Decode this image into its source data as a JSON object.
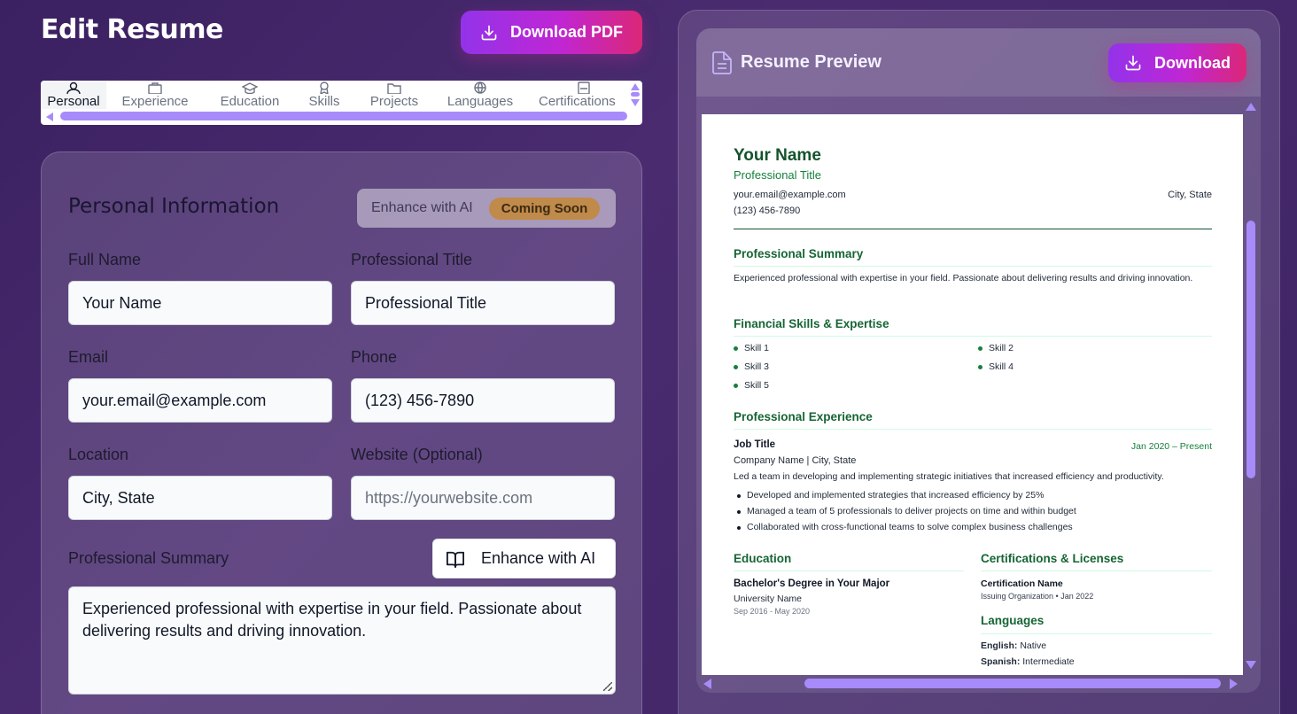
{
  "header": {
    "title": "Edit Resume",
    "download_pdf_label": "Download PDF"
  },
  "tabs": [
    {
      "label": "Personal",
      "icon": "user-icon",
      "active": true
    },
    {
      "label": "Experience",
      "icon": "briefcase-icon",
      "active": false
    },
    {
      "label": "Education",
      "icon": "graduation-cap-icon",
      "active": false
    },
    {
      "label": "Skills",
      "icon": "award-icon",
      "active": false
    },
    {
      "label": "Projects",
      "icon": "folder-icon",
      "active": false
    },
    {
      "label": "Languages",
      "icon": "globe-icon",
      "active": false
    },
    {
      "label": "Certifications",
      "icon": "certificate-icon",
      "active": false
    }
  ],
  "form": {
    "section_title": "Personal Information",
    "enhance_label": "Enhance with AI",
    "coming_soon": "Coming Soon",
    "full_name_label": "Full Name",
    "full_name_value": "Your Name",
    "title_label": "Professional Title",
    "title_value": "Professional Title",
    "email_label": "Email",
    "email_value": "your.email@example.com",
    "phone_label": "Phone",
    "phone_value": "(123) 456-7890",
    "location_label": "Location",
    "location_value": "City, State",
    "website_label": "Website (Optional)",
    "website_placeholder": "https://yourwebsite.com",
    "summary_label": "Professional Summary",
    "enhance_button_label": "Enhance with AI",
    "summary_value": "Experienced professional with expertise in your field. Passionate about delivering results and driving innovation."
  },
  "preview": {
    "title": "Resume Preview",
    "download_label": "Download",
    "resume": {
      "name": "Your Name",
      "title": "Professional Title",
      "email": "your.email@example.com",
      "location": "City, State",
      "phone": "(123) 456-7890",
      "summary_heading": "Professional Summary",
      "summary_text": "Experienced professional with expertise in your field. Passionate about delivering results and driving innovation.",
      "skills_heading": "Financial Skills & Expertise",
      "skills": [
        "Skill 1",
        "Skill 2",
        "Skill 3",
        "Skill 4",
        "Skill 5"
      ],
      "experience_heading": "Professional Experience",
      "job_title": "Job Title",
      "job_dates": "Jan 2020 – Present",
      "company": "Company Name | City, State",
      "job_description": "Led a team in developing and implementing strategic initiatives that increased efficiency and productivity.",
      "achievements": [
        "Developed and implemented strategies that increased efficiency by 25%",
        "Managed a team of 5 professionals to deliver projects on time and within budget",
        "Collaborated with cross-functional teams to solve complex business challenges"
      ],
      "education_heading": "Education",
      "degree": "Bachelor's Degree in Your Major",
      "university": "University Name",
      "edu_dates": "Sep 2016 - May 2020",
      "certs_heading": "Certifications & Licenses",
      "cert_name": "Certification Name",
      "cert_org": "Issuing Organization • Jan 2022",
      "languages_heading": "Languages",
      "languages": [
        {
          "name": "English:",
          "level": "Native"
        },
        {
          "name": "Spanish:",
          "level": "Intermediate"
        }
      ]
    }
  },
  "colors": {
    "accent_gradient_start": "#9333ea",
    "accent_gradient_end": "#db2777",
    "resume_green": "#166534",
    "scrollbar": "#a78bfa"
  }
}
